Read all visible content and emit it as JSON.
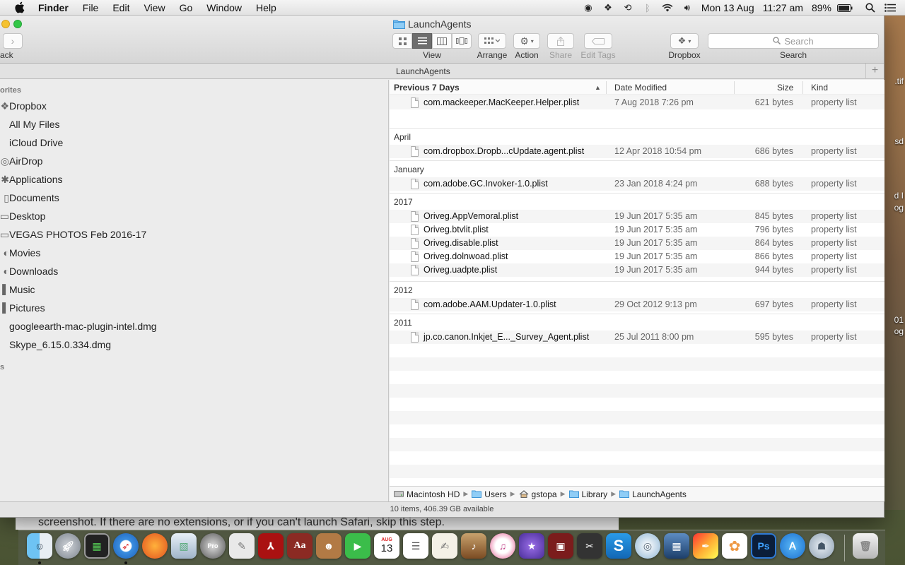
{
  "menubar": {
    "app": "Finder",
    "items": [
      "File",
      "Edit",
      "View",
      "Go",
      "Window",
      "Help"
    ],
    "date": "Mon 13 Aug",
    "time": "11:27 am",
    "battery": "89%"
  },
  "window": {
    "title": "LaunchAgents",
    "back_label": "ack",
    "toolbar": {
      "view": "View",
      "arrange": "Arrange",
      "action": "Action",
      "share": "Share",
      "edit_tags": "Edit Tags",
      "dropbox": "Dropbox",
      "search_label": "Search",
      "search_placeholder": "Search"
    },
    "tab_title": "LaunchAgents",
    "status": "10 items, 406.39 GB available"
  },
  "sidebar": {
    "favorites_heading": "orites",
    "items": [
      {
        "label": "Dropbox",
        "icon": "dropbox-icon"
      },
      {
        "label": "All My Files",
        "icon": "all-files-icon"
      },
      {
        "label": "iCloud Drive",
        "icon": "cloud-icon"
      },
      {
        "label": "AirDrop",
        "icon": "airdrop-icon"
      },
      {
        "label": "Applications",
        "icon": "applications-icon"
      },
      {
        "label": "Documents",
        "icon": "documents-icon"
      },
      {
        "label": "Desktop",
        "icon": "desktop-icon"
      },
      {
        "label": "VEGAS PHOTOS Feb 2016-17",
        "icon": "folder-icon"
      },
      {
        "label": "Movies",
        "icon": "movies-icon"
      },
      {
        "label": "Downloads",
        "icon": "downloads-icon"
      },
      {
        "label": "Music",
        "icon": "music-icon"
      },
      {
        "label": "Pictures",
        "icon": "pictures-icon"
      },
      {
        "label": "googleearth-mac-plugin-intel.dmg",
        "icon": "disk-image-icon"
      },
      {
        "label": "Skype_6.15.0.334.dmg",
        "icon": "disk-image-icon"
      }
    ],
    "second_heading": "s"
  },
  "columns": {
    "name": "Previous 7 Days",
    "date": "Date Modified",
    "size": "Size",
    "kind": "Kind"
  },
  "groups": [
    {
      "label": "Previous 7 Days",
      "files": [
        {
          "name": "com.mackeeper.MacKeeper.Helper.plist",
          "date": "7 Aug 2018 7:26 pm",
          "size": "621 bytes",
          "kind": "property list"
        }
      ]
    },
    {
      "label": "April",
      "files": [
        {
          "name": "com.dropbox.Dropb...cUpdate.agent.plist",
          "date": "12 Apr 2018 10:54 pm",
          "size": "686 bytes",
          "kind": "property list"
        }
      ]
    },
    {
      "label": "January",
      "files": [
        {
          "name": "com.adobe.GC.Invoker-1.0.plist",
          "date": "23 Jan 2018 4:24 pm",
          "size": "688 bytes",
          "kind": "property list"
        }
      ]
    },
    {
      "label": "2017",
      "files": [
        {
          "name": "Oriveg.AppVemoral.plist",
          "date": "19 Jun 2017 5:35 am",
          "size": "845 bytes",
          "kind": "property list"
        },
        {
          "name": "Oriveg.btvlit.plist",
          "date": "19 Jun 2017 5:35 am",
          "size": "796 bytes",
          "kind": "property list"
        },
        {
          "name": "Oriveg.disable.plist",
          "date": "19 Jun 2017 5:35 am",
          "size": "864 bytes",
          "kind": "property list"
        },
        {
          "name": "Oriveg.dolnwoad.plist",
          "date": "19 Jun 2017 5:35 am",
          "size": "866 bytes",
          "kind": "property list"
        },
        {
          "name": "Oriveg.uadpte.plist",
          "date": "19 Jun 2017 5:35 am",
          "size": "944 bytes",
          "kind": "property list"
        }
      ]
    },
    {
      "label": "2012",
      "files": [
        {
          "name": "com.adobe.AAM.Updater-1.0.plist",
          "date": "29 Oct 2012 9:13 pm",
          "size": "697 bytes",
          "kind": "property list"
        }
      ]
    },
    {
      "label": "2011",
      "files": [
        {
          "name": "jp.co.canon.Inkjet_E..._Survey_Agent.plist",
          "date": "25 Jul 2011 8:00 pm",
          "size": "595 bytes",
          "kind": "property list"
        }
      ]
    }
  ],
  "pathbar": [
    "Macintosh HD",
    "Users",
    "gstopa",
    "Library",
    "LaunchAgents"
  ],
  "behind_text": "screenshot. If there are no extensions, or if you can't launch Safari, skip this step.",
  "desktop_labels": [
    ".tif",
    "sd",
    "d I",
    "og",
    "01",
    "og"
  ],
  "dock": {
    "calendar_day": "13",
    "calendar_month": "AUG",
    "items": [
      "finder",
      "launchpad",
      "activity-monitor",
      "safari",
      "firefox",
      "preview",
      "google-earth",
      "script-editor",
      "acrobat",
      "dictionary",
      "contacts",
      "facetime",
      "calendar",
      "reminders",
      "textedit",
      "garageband",
      "itunes",
      "imovie",
      "photo-booth",
      "bowtie",
      "sketchbook",
      "screen-shot",
      "image-capture",
      "pixelmator",
      "photos",
      "photoshop",
      "app-store",
      "automator",
      "trash"
    ]
  }
}
